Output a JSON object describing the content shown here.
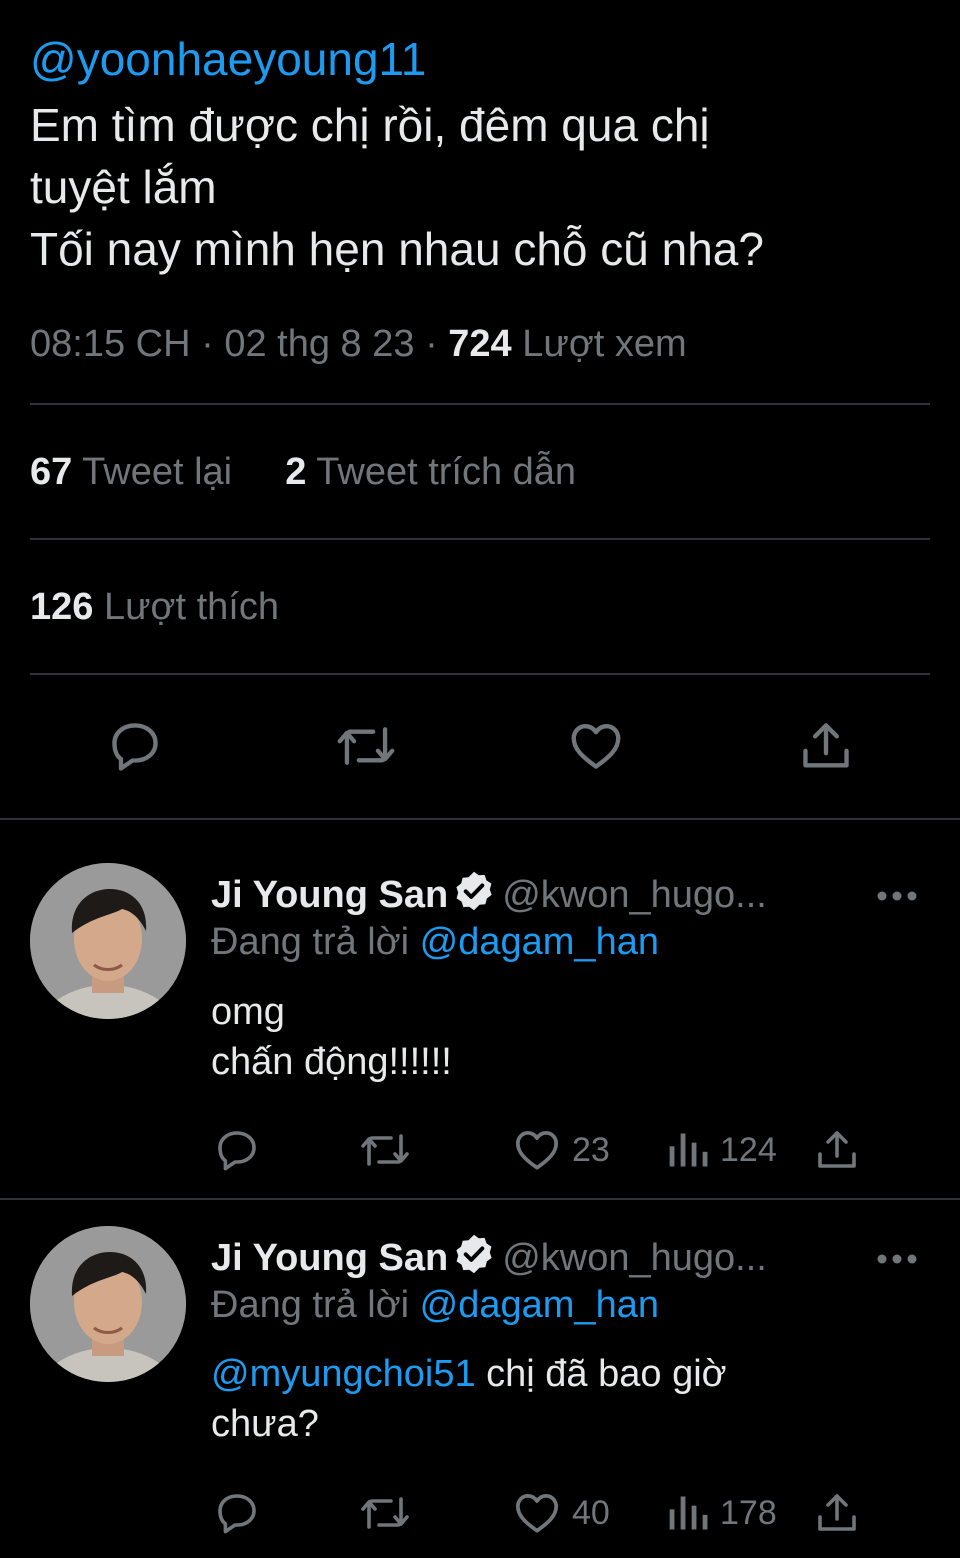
{
  "tweet": {
    "mention": "@yoonhaeyoung11",
    "text": "Em tìm được chị rồi, đêm qua chị\ntuyệt lắm\nTối nay mình hẹn nhau chỗ cũ nha?",
    "time": "08:15 CH",
    "date": "02 thg 8 23",
    "views": "724",
    "views_label": "Lượt xem",
    "retweets": "67",
    "retweets_label": "Tweet lại",
    "quotes": "2",
    "quotes_label": "Tweet trích dẫn",
    "likes": "126",
    "likes_label": "Lượt thích"
  },
  "actions": [
    "reply-icon",
    "retweet-icon",
    "like-icon",
    "share-icon"
  ],
  "replies": [
    {
      "name": "Ji Young San",
      "handle": "@kwon_hugo...",
      "replying_label": "Đang trả lời",
      "replying_to": "@dagam_han",
      "mention": "",
      "text": "omg\nchấn động!!!!!!",
      "likes": "23",
      "views": "124"
    },
    {
      "name": "Ji Young San",
      "handle": "@kwon_hugo...",
      "replying_label": "Đang trả lời",
      "replying_to": "@dagam_han",
      "mention": "@myungchoi51",
      "text": " chị đã bao giờ\nchưa?",
      "likes": "40",
      "views": "178"
    }
  ],
  "colors": {
    "background": "#000000",
    "text": "#e7e9ea",
    "secondary": "#71767b",
    "accent": "#1d9bf0",
    "divider": "#2f3336"
  }
}
